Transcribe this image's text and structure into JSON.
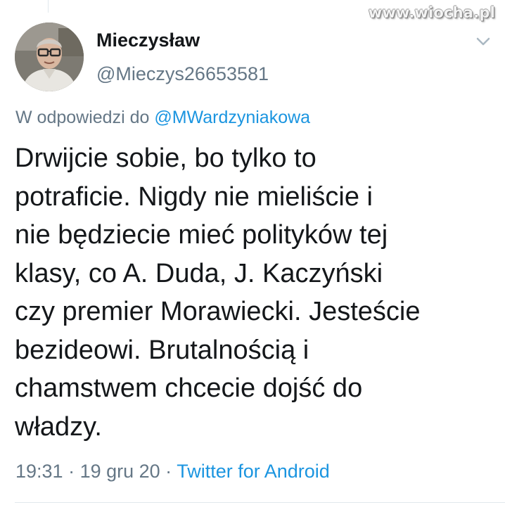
{
  "watermark": {
    "domain": "www.wiocha",
    "tld": ".pl"
  },
  "tweet": {
    "author": {
      "name": "Mieczysław",
      "handle": "@Mieczys26653581"
    },
    "reply_to": {
      "prefix": "W odpowiedzi do",
      "mention": "@MWardzyniakowa"
    },
    "lines": [
      "Drwijcie sobie, bo tylko to",
      "potraficie. Nigdy nie mieliście i",
      "nie będziecie mieć polityków tej",
      "klasy, co A. Duda, J. Kaczyński",
      "czy premier Morawiecki. Jesteście",
      "bezideowi. Brutalnością i",
      "chamstwem chcecie dojść do",
      "władzy."
    ],
    "meta": {
      "time": "19:31",
      "separator": " · ",
      "date": "19 gru 20",
      "source": "Twitter for Android"
    }
  },
  "icons": {
    "menu": "chevron-down-icon"
  },
  "colors": {
    "text": "#14171a",
    "secondary": "#657786",
    "link": "#1b95e0",
    "divider": "#e1e8ed"
  }
}
